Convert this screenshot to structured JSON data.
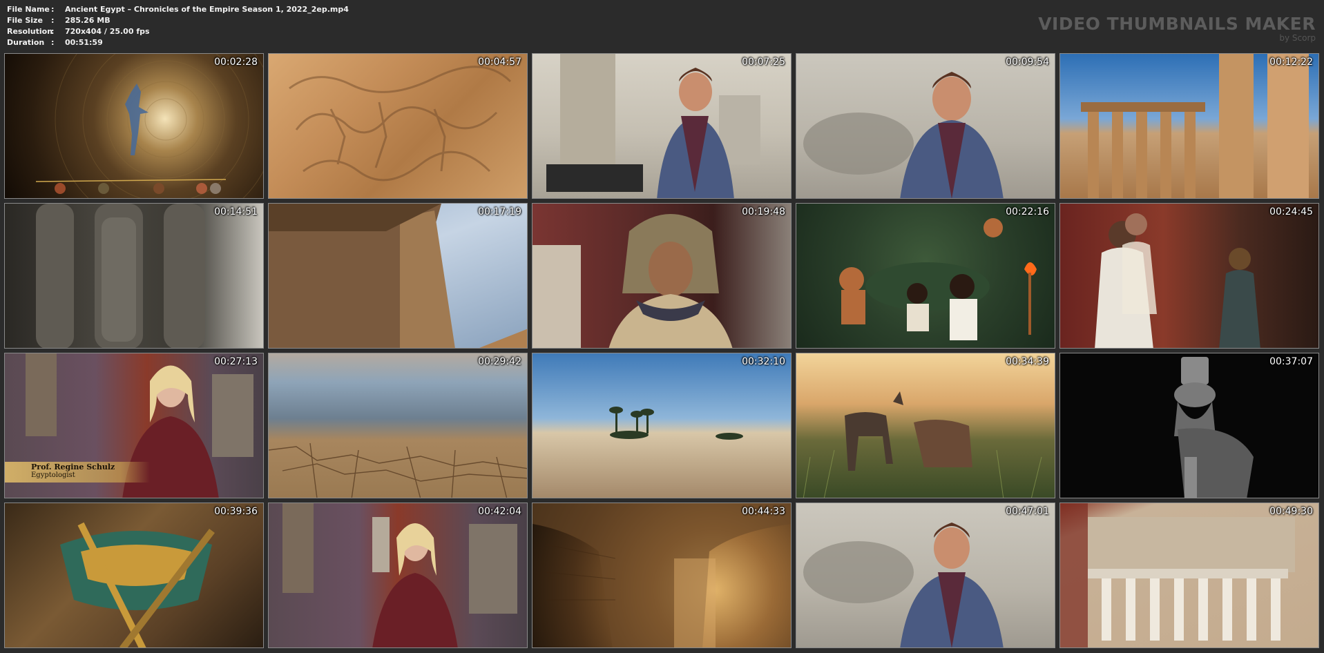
{
  "file_info": [
    {
      "key": "File Name",
      "value": "Ancient Egypt – Chronicles of the Empire Season 1, 2022_2ep.mp4"
    },
    {
      "key": "File Size",
      "value": "285.26 MB"
    },
    {
      "key": "Resolution",
      "value": "720x404 / 25.00 fps"
    },
    {
      "key": "Duration",
      "value": "00:51:59"
    }
  ],
  "separator": ":",
  "brand": {
    "title": "VIDEO THUMBNAILS MAKER",
    "subtitle": "by Scorp"
  },
  "thumbnails": [
    {
      "time": "00:02:28",
      "scene": "timeline-tunnel"
    },
    {
      "time": "00:04:57",
      "scene": "stone-relief"
    },
    {
      "time": "00:07:25",
      "scene": "interview-museum"
    },
    {
      "time": "00:09:54",
      "scene": "interview-sphinx"
    },
    {
      "time": "00:12:22",
      "scene": "temple-columns"
    },
    {
      "time": "00:14:51",
      "scene": "statues"
    },
    {
      "time": "00:17:19",
      "scene": "pylon-sky"
    },
    {
      "time": "00:19:48",
      "scene": "pharaoh-actor"
    },
    {
      "time": "00:22:16",
      "scene": "animated-feast"
    },
    {
      "time": "00:24:45",
      "scene": "palace-scene"
    },
    {
      "time": "00:27:13",
      "scene": "interview-schulz",
      "lower_third": {
        "name": "Prof. Regine Schulz",
        "role": "Egyptologist"
      }
    },
    {
      "time": "00:29:42",
      "scene": "cracked-earth"
    },
    {
      "time": "00:32:10",
      "scene": "desert-oasis"
    },
    {
      "time": "00:34:39",
      "scene": "goats-sunset"
    },
    {
      "time": "00:37:07",
      "scene": "hathor-statue"
    },
    {
      "time": "00:39:36",
      "scene": "pharaoh-collar"
    },
    {
      "time": "00:42:04",
      "scene": "interview-schulz-2"
    },
    {
      "time": "00:44:33",
      "scene": "tomb-corridor"
    },
    {
      "time": "00:47:01",
      "scene": "interview-sphinx-2"
    },
    {
      "time": "00:49:30",
      "scene": "temple-model"
    }
  ]
}
